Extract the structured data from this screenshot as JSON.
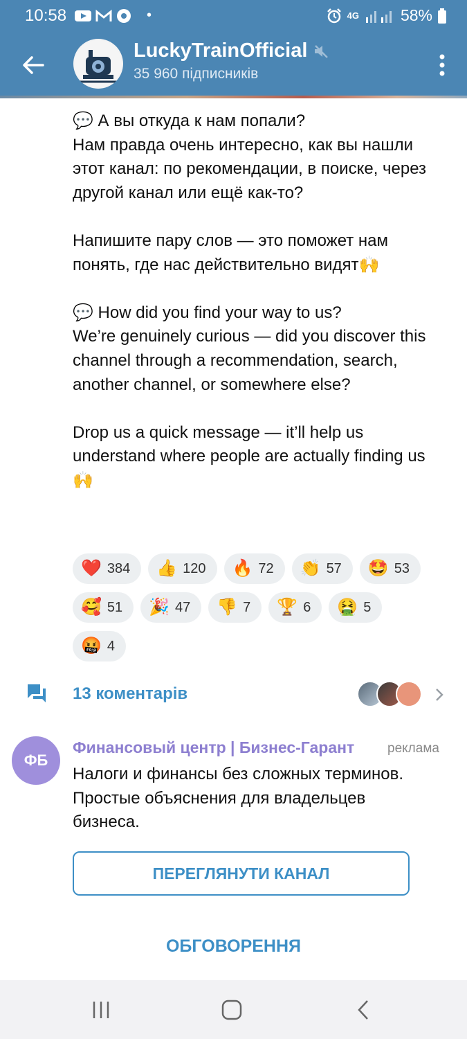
{
  "status_bar": {
    "time": "10:58",
    "dot": "•",
    "network": "4G",
    "battery": "58%",
    "left_icons": [
      "youtube-icon",
      "gmail-icon",
      "chrome-icon"
    ],
    "right_icons": [
      "alarm-icon",
      "network-icon",
      "signal-icon",
      "battery-icon"
    ]
  },
  "header": {
    "channel_name": "LuckyTrainOfficial",
    "subscribers": "35 960 підписників",
    "muted": true,
    "color": "#4b86b4"
  },
  "message": {
    "text": "💬 А вы откуда к нам попали?\nНам правда очень интересно, как вы нашли этот канал: по рекомендации, в поиске, через другой канал или ещё как-то?\n\nНапишите пару слов — это поможет нам понять, где нас действительно видят🙌\n\n💬 How did you find your way to us?\nWe’re genuinely curious — did you discover this channel through a recommendation, search, another channel, or somewhere else?\n\nDrop us a quick message — it’ll help us understand where people are actually finding us🙌"
  },
  "reactions": [
    {
      "emoji": "❤️",
      "count": "384"
    },
    {
      "emoji": "👍",
      "count": "120"
    },
    {
      "emoji": "🔥",
      "count": "72"
    },
    {
      "emoji": "👏",
      "count": "57"
    },
    {
      "emoji": "🤩",
      "count": "53"
    },
    {
      "emoji": "🥰",
      "count": "51"
    },
    {
      "emoji": "🎉",
      "count": "47"
    },
    {
      "emoji": "👎",
      "count": "7"
    },
    {
      "emoji": "🏆",
      "count": "6"
    },
    {
      "emoji": "🤮",
      "count": "5"
    },
    {
      "emoji": "🤬",
      "count": "4"
    }
  ],
  "comments": {
    "label": "13 коментарів",
    "accent": "#3d8fc6"
  },
  "ad": {
    "avatar_initials": "ФБ",
    "title": "Финансовый центр | Бизнес-Гарант",
    "tag": "реклама",
    "text": "Налоги и финансы без сложных терминов. Простые объяснения для владельцев бизнеса.",
    "button": "ПЕРЕГЛЯНУТИ КАНАЛ",
    "avatar_color": "#9f8fdc"
  },
  "discussion_button": "ОБГОВОРЕННЯ"
}
